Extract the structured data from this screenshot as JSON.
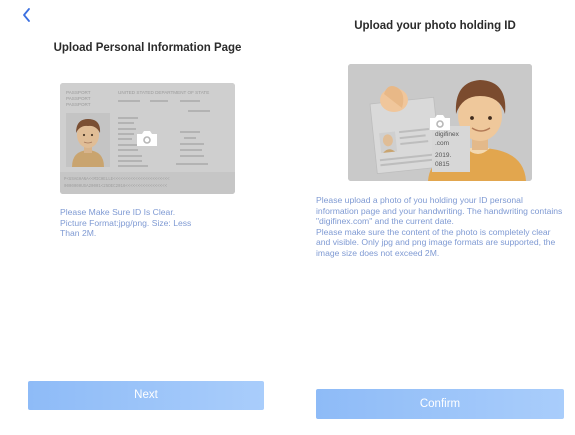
{
  "header": {
    "back_icon": "chevron-left-icon"
  },
  "left_panel": {
    "title": "Upload Personal Information Page",
    "id_card": {
      "header": "UNITED STATED DEPARTMENT OF STATE",
      "label_passport": "PASSPORT",
      "label_passport_2": "PASSPORT",
      "label_passport_3": "PASSPORT",
      "mrz_line_1": "P<USAGHANA<<MICHELLE<<<<<<<<<<<<<<<<<<<<<<<",
      "mrz_line_2": "0000000USA20001<25DEC2016<<<<<<<<<<<<<<<<<"
    },
    "hint_lines": [
      "Please Make Sure ID Is Clear.",
      "Picture Format:jpg/png. Size: Less",
      "Than 2M."
    ],
    "next_label": "Next"
  },
  "right_panel": {
    "title": "Upload your photo holding ID",
    "note_lines": [
      "digifinex",
      ".com",
      "2019.",
      "0815"
    ],
    "hint_paragraph_1": "Please upload a photo of you holding your ID personal information page and your handwriting. The handwriting contains \"digifinex.com\" and the current date.",
    "hint_paragraph_2": "Please make sure the content of the photo is completely clear and visible. Only jpg and png image formats are supported, the image size does not exceed 2M.",
    "confirm_label": "Confirm"
  },
  "colors": {
    "accent_text": "#7f9ad3",
    "button_start": "#8ebbf7",
    "button_end": "#a9cdfb",
    "back_icon": "#3b6fe0"
  }
}
